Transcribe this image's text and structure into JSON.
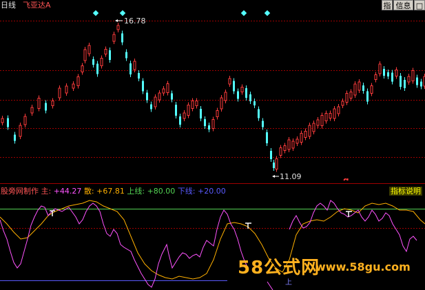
{
  "header": {
    "period_label": "日线",
    "stock_name": "飞亚达A"
  },
  "toolbar": {
    "btn_zhi": "指",
    "btn_info": "信息",
    "btn_close": "□"
  },
  "main_chart": {
    "high_label": "16.78",
    "low_label": "11.09",
    "marker_q": "q"
  },
  "indicator": {
    "source": "股旁网制作",
    "main_label": "主:",
    "main_value": "+44.27",
    "san_label": "散:",
    "san_value": "+67.81",
    "upper_label": "上线:",
    "upper_value": "+80.00",
    "lower_label": "下线:",
    "lower_value": "+20.00",
    "help_button": "指标说明",
    "mark_symbol": "下",
    "bottom_mark": "上"
  },
  "watermark": {
    "text": "58公式网",
    "url": "www.58gu.com"
  },
  "colors": {
    "up": "#ff3c3c",
    "down": "#54ffff",
    "main_line": "#ff54ff",
    "san_line": "#ffb000",
    "upper_line": "#54d454",
    "lower_line": "#5a5aff",
    "grid": "#a00000"
  }
}
